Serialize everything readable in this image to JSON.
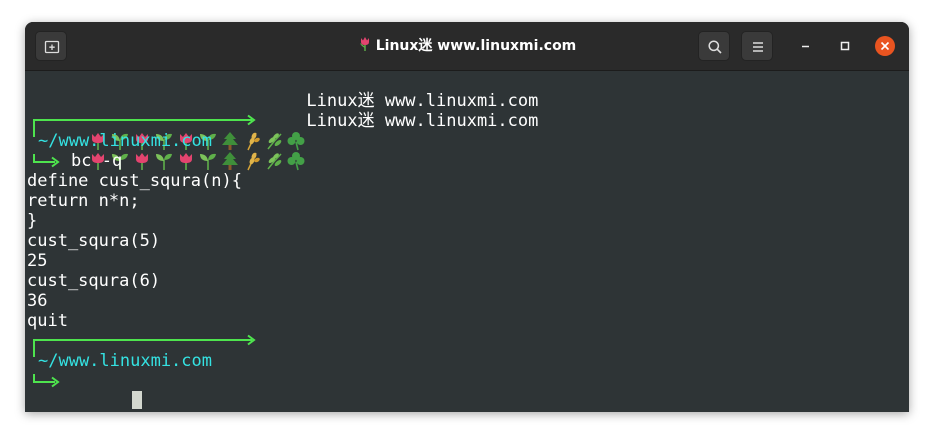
{
  "window": {
    "title": "Linux迷 www.linuxmi.com"
  },
  "terminal": {
    "banner_lines": [
      "Linux迷 www.linuxmi.com",
      "Linux迷 www.linuxmi.com"
    ],
    "session1": {
      "path": "~/www.linuxmi.com",
      "command": "bc -q",
      "output": [
        "define cust_squra(n){",
        "return n*n;",
        "}",
        "cust_squra(5)",
        "25",
        "cust_squra(6)",
        "36",
        "quit"
      ]
    },
    "session2": {
      "path": "~/www.linuxmi.com",
      "command": ""
    }
  },
  "icons": {
    "new_tab": "new-tab-icon",
    "search": "search-icon",
    "menu": "hamburger-menu-icon",
    "minimize": "minimize-icon",
    "maximize": "maximize-icon",
    "close": "close-icon",
    "banner": [
      "tulip-icon",
      "seedling-icon",
      "evergreen-tree-icon",
      "wheat-icon",
      "herb-icon",
      "shamrock-icon"
    ]
  },
  "colors": {
    "terminal_bg": "#2e3436",
    "titlebar_bg": "#2a2a2a",
    "prompt_green": "#4ee44e",
    "path_cyan": "#34e2e2",
    "close_orange": "#e95420"
  }
}
